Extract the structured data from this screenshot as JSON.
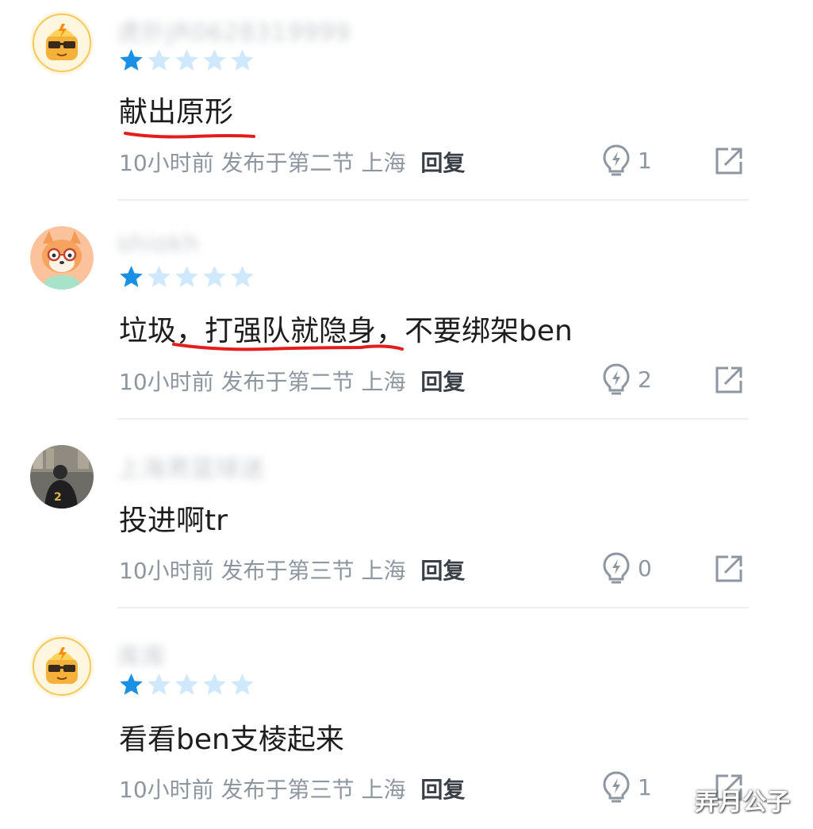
{
  "comments": [
    {
      "username": "虎扑JR0628319999",
      "avatar": "hupu-robot-avatar",
      "rating": 1,
      "rating_max": 5,
      "text": "献出原形",
      "time": "10小时前",
      "published": "发布于第二节",
      "location": "上海",
      "reply_label": "回复",
      "likes": "1"
    },
    {
      "username": "shiokh",
      "avatar": "fox-glasses-avatar",
      "rating": 1,
      "rating_max": 5,
      "text": "垃圾，打强队就隐身，不要绑架ben",
      "time": "10小时前",
      "published": "发布于第二节",
      "location": "上海",
      "reply_label": "回复",
      "likes": "2"
    },
    {
      "username": "上海男篮球迷",
      "avatar": "photo-avatar",
      "rating": 0,
      "rating_max": 0,
      "text": "投进啊tr",
      "time": "10小时前",
      "published": "发布于第三节",
      "location": "上海",
      "reply_label": "回复",
      "likes": "0"
    },
    {
      "username": "库库",
      "avatar": "hupu-robot-avatar",
      "rating": 1,
      "rating_max": 5,
      "text": "看看ben支棱起来",
      "time": "10小时前",
      "published": "发布于第三节",
      "location": "上海",
      "reply_label": "回复",
      "likes": "1"
    }
  ],
  "colors": {
    "star_filled": "#1a8fe6",
    "star_empty": "#cfe8fb",
    "underline": "#e51c1c",
    "meta_text": "#8e96a0"
  },
  "watermark": "弄月公子"
}
